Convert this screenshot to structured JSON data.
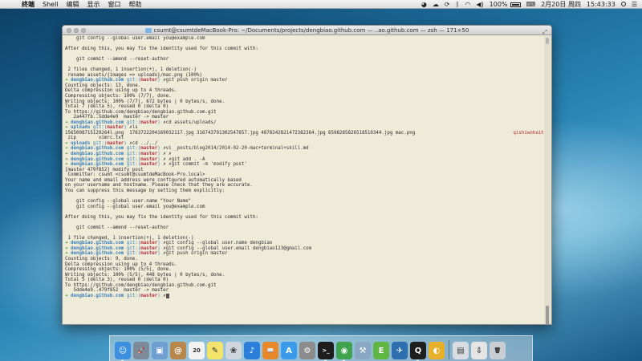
{
  "menubar": {
    "apple_glyph": "",
    "items": [
      "终端",
      "Shell",
      "编辑",
      "显示",
      "窗口",
      "帮助"
    ],
    "battery": "100%",
    "datetime": "2月20日 周四",
    "time": "15:43:33"
  },
  "terminal": {
    "title": "csumt@csumtdeMacBook-Pro: ~/Documents/projects/dengbiao.github.com — ..ao.github.com — zsh — 171×50",
    "lines": [
      {
        "segs": [
          {
            "t": "    git config --global user.email you@example.com",
            "c": ""
          }
        ]
      },
      {
        "segs": [
          {
            "t": "",
            "c": ""
          }
        ]
      },
      {
        "segs": [
          {
            "t": "After doing this, you may fix the identity used for this commit with:",
            "c": ""
          }
        ]
      },
      {
        "segs": [
          {
            "t": "",
            "c": ""
          }
        ]
      },
      {
        "segs": [
          {
            "t": "    git commit --amend --reset-author",
            "c": ""
          }
        ]
      },
      {
        "segs": [
          {
            "t": "",
            "c": ""
          }
        ]
      },
      {
        "segs": [
          {
            "t": " 2 files changed, 1 insertion(+), 1 deletion(-)",
            "c": ""
          }
        ]
      },
      {
        "segs": [
          {
            "t": " rename assets/{images => uploads}/mac.png (100%)",
            "c": ""
          }
        ]
      },
      {
        "segs": [
          {
            "t": "➜ ",
            "c": "arrow"
          },
          {
            "t": "dengbiao.github.com ",
            "c": "path"
          },
          {
            "t": "git:(",
            "c": "git"
          },
          {
            "t": "master",
            "c": "br"
          },
          {
            "t": ") ",
            "c": "git"
          },
          {
            "t": "✗git push origin master",
            "c": "x"
          }
        ]
      },
      {
        "segs": [
          {
            "t": "Counting objects: 13, done.",
            "c": ""
          }
        ]
      },
      {
        "segs": [
          {
            "t": "Delta compression using up to 4 threads.",
            "c": ""
          }
        ]
      },
      {
        "segs": [
          {
            "t": "Compressing objects: 100% (7/7), done.",
            "c": ""
          }
        ]
      },
      {
        "segs": [
          {
            "t": "Writing objects: 100% (7/7), 672 bytes | 0 bytes/s, done.",
            "c": ""
          }
        ]
      },
      {
        "segs": [
          {
            "t": "Total 7 (delta 5), reused 0 (delta 0)",
            "c": ""
          }
        ]
      },
      {
        "segs": [
          {
            "t": "To https://github.com/dengbiao/dengbiao.github.com.git",
            "c": ""
          }
        ]
      },
      {
        "segs": [
          {
            "t": "   2a447fb..5dde4e9  master -> master",
            "c": ""
          }
        ]
      },
      {
        "segs": [
          {
            "t": "➜ ",
            "c": "arrow"
          },
          {
            "t": "dengbiao.github.com ",
            "c": "path"
          },
          {
            "t": "git:(",
            "c": "git"
          },
          {
            "t": "master",
            "c": "br"
          },
          {
            "t": ") ",
            "c": "git"
          },
          {
            "t": "✗cd assets/uploads/",
            "c": "x"
          }
        ]
      },
      {
        "segs": [
          {
            "t": "➜ ",
            "c": "arrow"
          },
          {
            "t": "uploads ",
            "c": "path"
          },
          {
            "t": "git:(",
            "c": "git"
          },
          {
            "t": "master",
            "c": "br"
          },
          {
            "t": ") ",
            "c": "git"
          },
          {
            "t": "✗ls",
            "c": "x"
          }
        ]
      },
      {
        "segs": [
          {
            "t": "1565008715129264l.png  1763722204169032117.jpg 316743791302547657.jpg 4878242821472382364.jpg 6598285826518510344.jpg mac.png                                   ",
            "c": ""
          },
          {
            "t": "qishiwohaihao.mp3",
            "c": "red"
          },
          {
            "t": "         vim",
            "c": ""
          }
        ]
      },
      {
        "segs": [
          {
            "t": " zip        vimrc.txt",
            "c": ""
          }
        ]
      },
      {
        "segs": [
          {
            "t": "➜ ",
            "c": "arrow"
          },
          {
            "t": "uploads ",
            "c": "path"
          },
          {
            "t": "git:(",
            "c": "git"
          },
          {
            "t": "master",
            "c": "br"
          },
          {
            "t": ") ",
            "c": "git"
          },
          {
            "t": "✗cd ../../",
            "c": "x"
          }
        ]
      },
      {
        "segs": [
          {
            "t": "➜ ",
            "c": "arrow"
          },
          {
            "t": "dengbiao.github.com ",
            "c": "path"
          },
          {
            "t": "git:(",
            "c": "git"
          },
          {
            "t": "master",
            "c": "br"
          },
          {
            "t": ") ",
            "c": "git"
          },
          {
            "t": "✗vi _posts/blog2014/2014-02-20-mac+terminal+skill.md",
            "c": "x"
          }
        ]
      },
      {
        "segs": [
          {
            "t": "➜ ",
            "c": "arrow"
          },
          {
            "t": "dengbiao.github.com ",
            "c": "path"
          },
          {
            "t": "git:(",
            "c": "git"
          },
          {
            "t": "master",
            "c": "br"
          },
          {
            "t": ") ",
            "c": "git"
          },
          {
            "t": "✗ ✗",
            "c": "x"
          }
        ]
      },
      {
        "segs": [
          {
            "t": "➜ ",
            "c": "arrow"
          },
          {
            "t": "dengbiao.github.com ",
            "c": "path"
          },
          {
            "t": "git:(",
            "c": "git"
          },
          {
            "t": "master",
            "c": "br"
          },
          {
            "t": ") ",
            "c": "git"
          },
          {
            "t": "✗ ✗git add . -A",
            "c": "x"
          }
        ]
      },
      {
        "segs": [
          {
            "t": "➜ ",
            "c": "arrow"
          },
          {
            "t": "dengbiao.github.com ",
            "c": "path"
          },
          {
            "t": "git:(",
            "c": "git"
          },
          {
            "t": "master",
            "c": "br"
          },
          {
            "t": ") ",
            "c": "git"
          },
          {
            "t": "✗ ✗git commit -m 'modify post'",
            "c": "x"
          }
        ]
      },
      {
        "segs": [
          {
            "t": "[master 479f852] modify post",
            "c": ""
          }
        ]
      },
      {
        "segs": [
          {
            "t": " Committer: csumt <csumt@csumtdeMacBook-Pro.local>",
            "c": ""
          }
        ]
      },
      {
        "segs": [
          {
            "t": "Your name and email address were configured automatically based",
            "c": ""
          }
        ]
      },
      {
        "segs": [
          {
            "t": "on your username and hostname. Please check that they are accurate.",
            "c": ""
          }
        ]
      },
      {
        "segs": [
          {
            "t": "You can suppress this message by setting them explicitly:",
            "c": ""
          }
        ]
      },
      {
        "segs": [
          {
            "t": "",
            "c": ""
          }
        ]
      },
      {
        "segs": [
          {
            "t": "    git config --global user.name \"Your Name\"",
            "c": ""
          }
        ]
      },
      {
        "segs": [
          {
            "t": "    git config --global user.email you@example.com",
            "c": ""
          }
        ]
      },
      {
        "segs": [
          {
            "t": "",
            "c": ""
          }
        ]
      },
      {
        "segs": [
          {
            "t": "After doing this, you may fix the identity used for this commit with:",
            "c": ""
          }
        ]
      },
      {
        "segs": [
          {
            "t": "",
            "c": ""
          }
        ]
      },
      {
        "segs": [
          {
            "t": "    git commit --amend --reset-author",
            "c": ""
          }
        ]
      },
      {
        "segs": [
          {
            "t": "",
            "c": ""
          }
        ]
      },
      {
        "segs": [
          {
            "t": " 1 file changed, 1 insertion(+), 1 deletion(-)",
            "c": ""
          }
        ]
      },
      {
        "segs": [
          {
            "t": "➜ ",
            "c": "arrow"
          },
          {
            "t": "dengbiao.github.com ",
            "c": "path"
          },
          {
            "t": "git:(",
            "c": "git"
          },
          {
            "t": "master",
            "c": "br"
          },
          {
            "t": ") ",
            "c": "git"
          },
          {
            "t": "✗git config --global user.name dengbiao",
            "c": "x"
          }
        ]
      },
      {
        "segs": [
          {
            "t": "➜ ",
            "c": "arrow"
          },
          {
            "t": "dengbiao.github.com ",
            "c": "path"
          },
          {
            "t": "git:(",
            "c": "git"
          },
          {
            "t": "master",
            "c": "br"
          },
          {
            "t": ") ",
            "c": "git"
          },
          {
            "t": "✗git config --global user.email dengbiao123@gmail.com",
            "c": "x"
          }
        ]
      },
      {
        "segs": [
          {
            "t": "➜ ",
            "c": "arrow"
          },
          {
            "t": "dengbiao.github.com ",
            "c": "path"
          },
          {
            "t": "git:(",
            "c": "git"
          },
          {
            "t": "master",
            "c": "br"
          },
          {
            "t": ") ",
            "c": "git"
          },
          {
            "t": "✗git push origin master",
            "c": "x"
          }
        ]
      },
      {
        "segs": [
          {
            "t": "Counting objects: 9, done.",
            "c": ""
          }
        ]
      },
      {
        "segs": [
          {
            "t": "Delta compression using up to 4 threads.",
            "c": ""
          }
        ]
      },
      {
        "segs": [
          {
            "t": "Compressing objects: 100% (5/5), done.",
            "c": ""
          }
        ]
      },
      {
        "segs": [
          {
            "t": "Writing objects: 100% (5/5), 448 bytes | 0 bytes/s, done.",
            "c": ""
          }
        ]
      },
      {
        "segs": [
          {
            "t": "Total 5 (delta 3), reused 0 (delta 0)",
            "c": ""
          }
        ]
      },
      {
        "segs": [
          {
            "t": "To https://github.com/dengbiao/dengbiao.github.com.git",
            "c": ""
          }
        ]
      },
      {
        "segs": [
          {
            "t": "   5dde4e9..479f852  master -> master",
            "c": ""
          }
        ]
      },
      {
        "segs": [
          {
            "t": "➜ ",
            "c": "arrow"
          },
          {
            "t": "dengbiao.github.com ",
            "c": "path"
          },
          {
            "t": "git:(",
            "c": "git"
          },
          {
            "t": "master",
            "c": "br"
          },
          {
            "t": ") ",
            "c": "git"
          },
          {
            "t": "✗",
            "c": "x"
          }
        ]
      }
    ]
  },
  "dock": {
    "apps": [
      {
        "name": "finder-icon",
        "glyph": "☺",
        "color": "#3d8fe0",
        "running": true
      },
      {
        "name": "launchpad-icon",
        "glyph": "🚀",
        "color": "#7d8a99",
        "running": false
      },
      {
        "name": "preview-icon",
        "glyph": "▣",
        "color": "#6e9fd0",
        "running": false
      },
      {
        "name": "contacts-icon",
        "glyph": "@",
        "color": "#b7874c",
        "running": false
      },
      {
        "name": "calendar-icon",
        "glyph": "20",
        "color": "#f2f2f2",
        "running": false
      },
      {
        "name": "notes-icon",
        "glyph": "✎",
        "color": "#f3e36a",
        "running": false
      },
      {
        "name": "photos-icon",
        "glyph": "❀",
        "color": "#cfd5dc",
        "running": false
      },
      {
        "name": "itunes-icon",
        "glyph": "♪",
        "color": "#2b7fd8",
        "running": false
      },
      {
        "name": "ibooks-icon",
        "glyph": "📖",
        "color": "#e7892b",
        "running": false
      },
      {
        "name": "app-store-icon",
        "glyph": "A",
        "color": "#3a9bea",
        "running": false
      },
      {
        "name": "system-preferences-icon",
        "glyph": "⚙",
        "color": "#8c8c8c",
        "running": false
      },
      {
        "name": "terminal-icon",
        "glyph": ">_",
        "color": "#1d1d1d",
        "running": true
      },
      {
        "name": "chrome-icon",
        "glyph": "◉",
        "color": "#3fa34d",
        "running": true
      },
      {
        "name": "xcode-icon",
        "glyph": "⚒",
        "color": "#8aa7c3",
        "running": false
      },
      {
        "name": "evernote-icon",
        "glyph": "E",
        "color": "#5fb643",
        "running": false
      },
      {
        "name": "sparrow-icon",
        "glyph": "✈",
        "color": "#2e6fb0",
        "running": false
      },
      {
        "name": "qq-icon",
        "glyph": "Q",
        "color": "#1e1e1e",
        "running": true
      },
      {
        "name": "chrome-app-icon",
        "glyph": "◐",
        "color": "#e7b02a",
        "running": false
      },
      {
        "name": "documents-folder-icon",
        "glyph": "▤",
        "color": "#d8dde3",
        "running": false
      },
      {
        "name": "downloads-folder-icon",
        "glyph": "⇩",
        "color": "#e5e5e5",
        "running": false
      },
      {
        "name": "trash-icon",
        "glyph": "🗑",
        "color": "#c9ced4",
        "running": false
      }
    ]
  }
}
